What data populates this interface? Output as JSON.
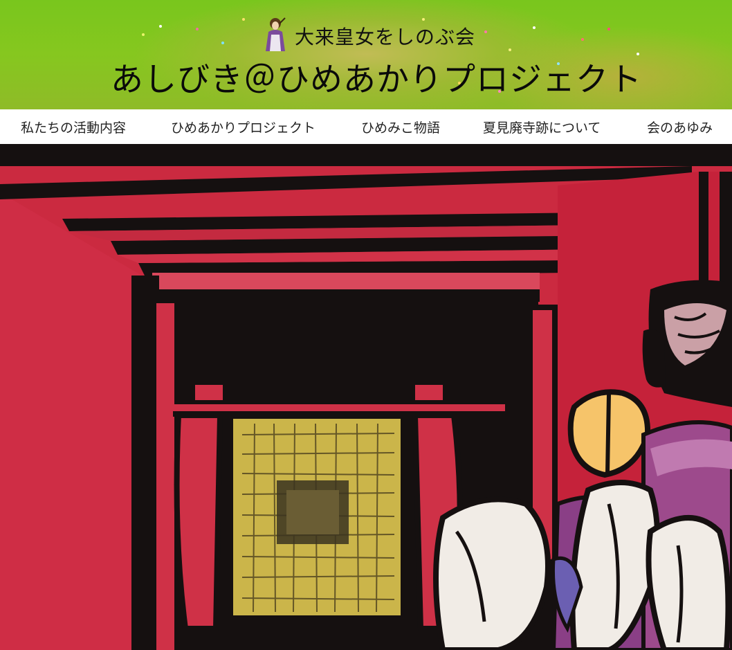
{
  "header": {
    "subtitle": "大来皇女をしのぶ会",
    "title": "あしびき＠ひめあかりプロジェクト",
    "logo_icon": "princess-figure-icon",
    "colors": {
      "background": "#79c61d",
      "text": "#111111"
    }
  },
  "nav": {
    "items": [
      {
        "label": "私たちの活動内容"
      },
      {
        "label": "ひめあかりプロジェクト"
      },
      {
        "label": "ひめみこ物語"
      },
      {
        "label": "夏見廃寺跡について"
      },
      {
        "label": "会のあゆみ"
      }
    ]
  },
  "hero": {
    "description_icon": "paper-cutout-temple-scene",
    "colors": {
      "red": "#c8243b",
      "black": "#151010",
      "gold": "#cbb54a",
      "purple": "#8a3f86",
      "pale": "#f1ece6"
    }
  }
}
